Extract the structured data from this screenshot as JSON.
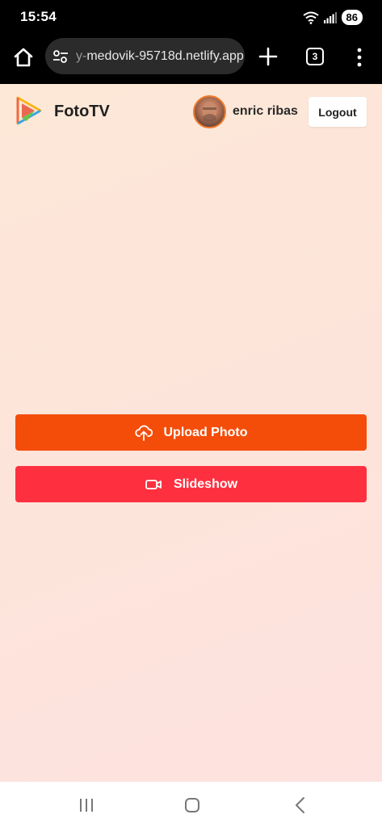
{
  "status_bar": {
    "time": "15:54",
    "battery": "86",
    "icons": [
      "wifi-icon",
      "signal-icon",
      "battery-icon"
    ]
  },
  "browser": {
    "url_faded": "y-",
    "url": "medovik-95718d.netlify.app",
    "tab_count": "3",
    "icons": [
      "home-icon",
      "site-settings-icon",
      "new-tab-icon",
      "more-menu-icon"
    ]
  },
  "header": {
    "app_name": "FotoTV",
    "user_name": "enric ribas",
    "logout_label": "Logout"
  },
  "actions": {
    "upload_label": "Upload Photo",
    "slideshow_label": "Slideshow"
  },
  "colors": {
    "upload_button": "#f44d0a",
    "slideshow_button": "#fe3040",
    "avatar_ring": "#f07a2c",
    "page_background": "#fde6dc"
  },
  "nav_bar": {
    "icons": [
      "recent-apps-icon",
      "home-nav-icon",
      "back-icon"
    ]
  }
}
